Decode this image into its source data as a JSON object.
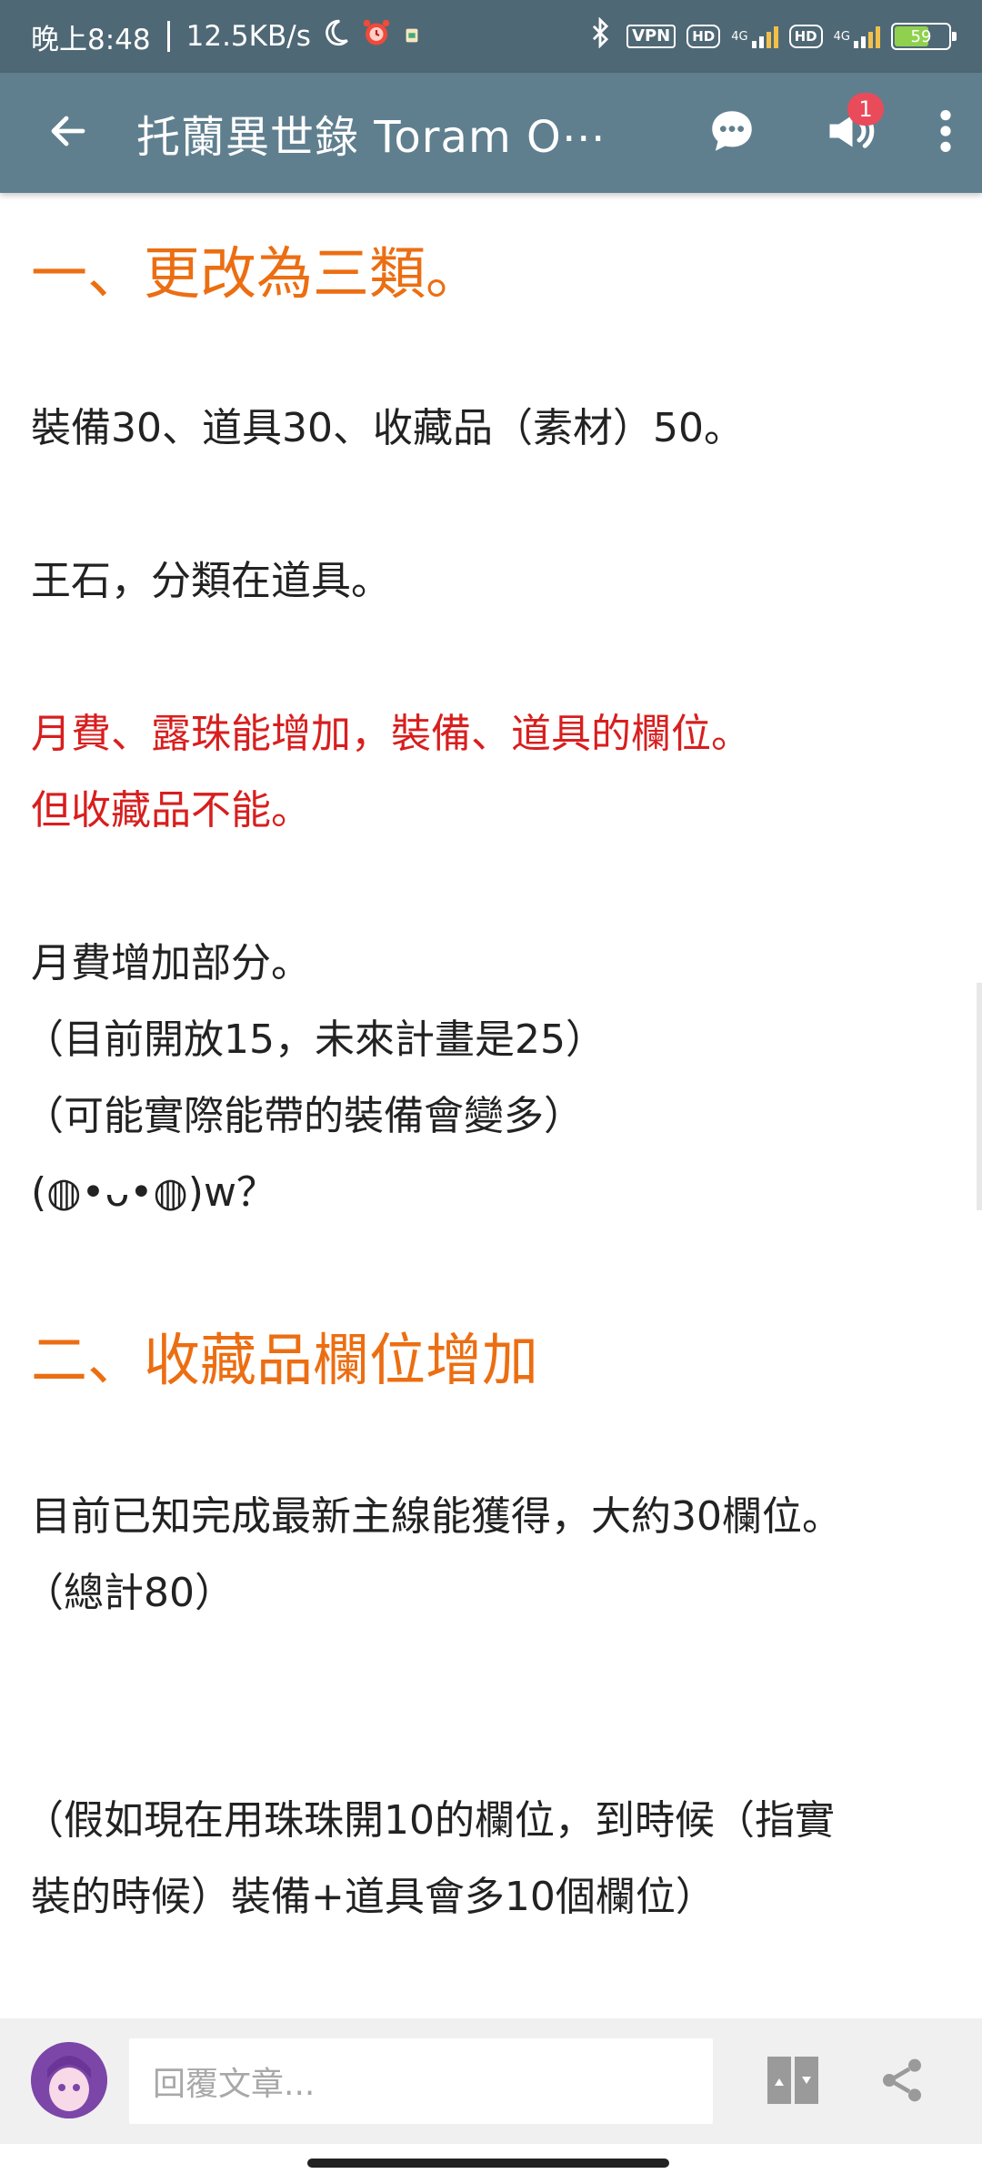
{
  "status_bar": {
    "time": "晚上8:48",
    "speed": "12.5KB/s",
    "vpn": "VPN",
    "hd1": "HD",
    "net1": "4G",
    "hd2": "HD",
    "net2": "4G",
    "battery": "59",
    "icons": [
      "moon-icon",
      "alarm-icon",
      "notification-icon",
      "bluetooth-icon",
      "signal-icon",
      "battery-icon"
    ]
  },
  "app_bar": {
    "title": "托蘭異世錄 Toram O⋯",
    "icons": [
      "back-arrow-icon",
      "chat-icon",
      "broadcast-icon",
      "more-vert-icon"
    ],
    "notification_count": "1"
  },
  "article": {
    "heading1": "一、更改為三類。",
    "p1": "裝備30、道具30、收藏品（素材）50。",
    "p2": "王石，分類在道具。",
    "red1": "月費、露珠能增加，裝備、道具的欄位。",
    "red2": "但收藏品不能。",
    "p3": "月費增加部分。",
    "p4": "（目前開放15，未來計畫是25）",
    "p5": "（可能實際能帶的裝備會變多）",
    "p6": "(◍•ᴗ•◍)w？",
    "heading2": "二、收藏品欄位增加",
    "p7": "目前已知完成最新主線能獲得，大約30欄位。",
    "p8": "（總計80）",
    "p9": "（假如現在用珠珠開10的欄位，到時候（指實",
    "p10": "裝的時候）裝備+道具會多10個欄位）"
  },
  "bottom_bar": {
    "reply_placeholder": "回覆文章...",
    "icons": [
      "avatar",
      "page-nav-icon",
      "share-icon"
    ]
  },
  "colors": {
    "status_bg": "#4f6875",
    "appbar_bg": "#5f7f8f",
    "heading_orange": "#ec6e12",
    "text_red": "#d81e1e",
    "badge_red": "#e94b5a"
  }
}
